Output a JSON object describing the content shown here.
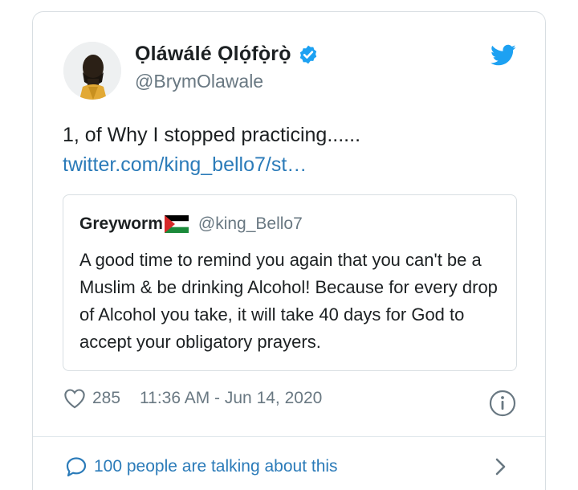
{
  "author": {
    "display_name": "Ọláwálé Ọlọ́fọ̀rọ̀",
    "handle": "@BrymOlawale",
    "verified": true
  },
  "tweet": {
    "text": "1, of Why I stopped practicing......",
    "link": "twitter.com/king_bello7/st…"
  },
  "quoted_tweet": {
    "display_name": "Greyworm",
    "handle": "@king_Bello7",
    "text": "A good time to remind you again that you can't be a Muslim & be drinking Alcohol! Because for every drop of Alcohol you take, it will take 40 days for God to accept your obligatory prayers."
  },
  "meta": {
    "like_count": "285",
    "timestamp": "11:36 AM - Jun 14, 2020"
  },
  "footer": {
    "talking_text": "100 people are talking about this"
  },
  "icons": {
    "verified": "verified-badge-icon",
    "brand": "twitter-bird-icon",
    "like": "heart-icon",
    "info": "info-icon",
    "reply": "speech-bubble-icon",
    "chevron": "chevron-right-icon",
    "flag": "palestine-flag-icon"
  },
  "colors": {
    "accent": "#1da1f2",
    "link": "#2b7bb9",
    "muted": "#697882",
    "text": "#1c2022",
    "border": "#d8dee2"
  }
}
